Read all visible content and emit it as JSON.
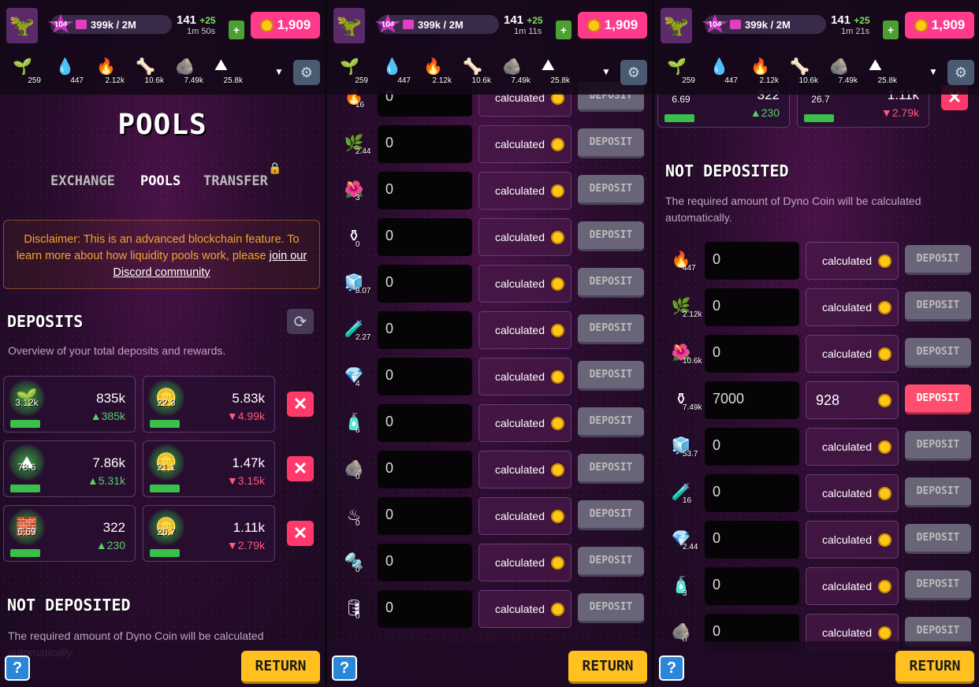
{
  "hud": {
    "level": "104",
    "xp": "399k / 2M",
    "energy": "141",
    "energy_bonus": "+25",
    "timers": [
      "1m 50s",
      "1m 11s",
      "1m 21s"
    ],
    "coins": "1,909",
    "resources": [
      {
        "icon": "plant-icon",
        "glyph": "🌱",
        "amount": "259"
      },
      {
        "icon": "water-drop-icon",
        "glyph": "💧",
        "amount": "447"
      },
      {
        "icon": "fire-icon",
        "glyph": "🔥",
        "amount": "2.12k"
      },
      {
        "icon": "bones-icon",
        "glyph": "🦴",
        "amount": "10.6k"
      },
      {
        "icon": "rock-icon",
        "glyph": "🪨",
        "amount": "7.49k"
      },
      {
        "icon": "sand-icon",
        "glyph": "⛰",
        "amount": "25.8k"
      }
    ]
  },
  "left": {
    "title": "POOLS",
    "tabs": [
      "EXCHANGE",
      "POOLS",
      "TRANSFER"
    ],
    "disclaimer": "Disclaimer: This is an advanced blockchain feature. To learn more about how liquidity pools work, please",
    "disclaimer_link": "join our Discord community",
    "deposits_title": "DEPOSITS",
    "deposits_sub": "Overview of your total deposits and rewards.",
    "pools": [
      {
        "a_label": "3.12k",
        "a_value": "835k",
        "a_change": "▲385k",
        "b_label": "22.3",
        "b_value": "5.83k",
        "b_change": "▼4.99k"
      },
      {
        "a_label": "78.6",
        "a_value": "7.86k",
        "a_change": "▲5.31k",
        "b_label": "21.1",
        "b_value": "1.47k",
        "b_change": "▼3.15k"
      },
      {
        "a_label": "6.69",
        "a_value": "322",
        "a_change": "▲230",
        "b_label": "26.7",
        "b_value": "1.11k",
        "b_change": "▼2.79k"
      }
    ],
    "not_deposited_title": "NOT DEPOSITED",
    "not_deposited_sub": "The required amount of Dyno Coin will be calculated automatically."
  },
  "middle": {
    "rows": [
      {
        "icon": "16",
        "input": "0",
        "calc": "calculated",
        "btn": "DEPOSIT"
      },
      {
        "icon": "2.44",
        "input": "0",
        "calc": "calculated",
        "btn": "DEPOSIT"
      },
      {
        "icon": "3",
        "input": "0",
        "calc": "calculated",
        "btn": "DEPOSIT"
      },
      {
        "icon": "0",
        "input": "0",
        "calc": "calculated",
        "btn": "DEPOSIT"
      },
      {
        "icon": "8.07",
        "input": "0",
        "calc": "calculated",
        "btn": "DEPOSIT"
      },
      {
        "icon": "2.27",
        "input": "0",
        "calc": "calculated",
        "btn": "DEPOSIT"
      },
      {
        "icon": "4",
        "input": "0",
        "calc": "calculated",
        "btn": "DEPOSIT"
      },
      {
        "icon": "6",
        "input": "0",
        "calc": "calculated",
        "btn": "DEPOSIT"
      },
      {
        "icon": "0",
        "input": "0",
        "calc": "calculated",
        "btn": "DEPOSIT"
      },
      {
        "icon": "0",
        "input": "0",
        "calc": "calculated",
        "btn": "DEPOSIT"
      },
      {
        "icon": "0",
        "input": "0",
        "calc": "calculated",
        "btn": "DEPOSIT"
      },
      {
        "icon": "0",
        "input": "0",
        "calc": "calculated",
        "btn": "DEPOSIT"
      }
    ]
  },
  "right": {
    "top_card": {
      "a_label": "6.69",
      "a_value": "322",
      "a_change": "▲230",
      "b_label": "26.7",
      "b_value": "1.11k",
      "b_change": "▼2.79k"
    },
    "title": "NOT DEPOSITED",
    "sub": "The required amount of Dyno Coin will be calculated automatically.",
    "rows": [
      {
        "icon": "447",
        "input": "0",
        "calc": "calculated",
        "btn": "DEPOSIT"
      },
      {
        "icon": "2.12k",
        "input": "0",
        "calc": "calculated",
        "btn": "DEPOSIT"
      },
      {
        "icon": "10.6k",
        "input": "0",
        "calc": "calculated",
        "btn": "DEPOSIT"
      },
      {
        "icon": "7.49k",
        "input": "7000",
        "calc": "928",
        "btn": "DEPOSIT"
      },
      {
        "icon": "53.7",
        "input": "0",
        "calc": "calculated",
        "btn": "DEPOSIT"
      },
      {
        "icon": "16",
        "input": "0",
        "calc": "calculated",
        "btn": "DEPOSIT"
      },
      {
        "icon": "2.44",
        "input": "0",
        "calc": "calculated",
        "btn": "DEPOSIT"
      },
      {
        "icon": "3",
        "input": "0",
        "calc": "calculated",
        "btn": "DEPOSIT"
      },
      {
        "icon": "0",
        "input": "0",
        "calc": "calculated",
        "btn": "DEPOSIT"
      }
    ]
  },
  "footer": {
    "help": "?",
    "return": "RETURN"
  }
}
